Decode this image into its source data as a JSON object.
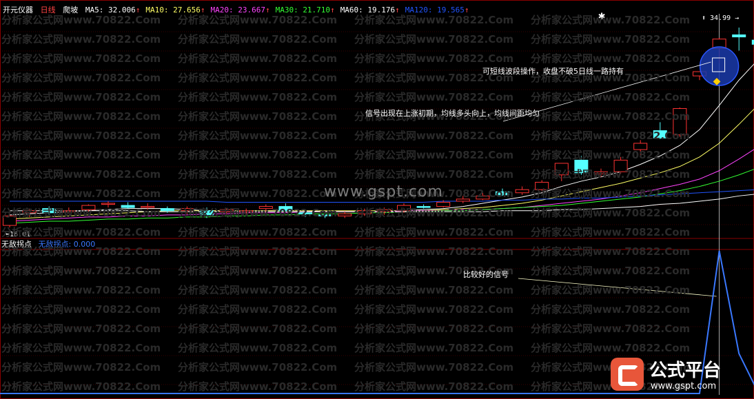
{
  "header": {
    "app_name": "开元仪器",
    "period": "日线",
    "indicator": "爬坡",
    "ma": [
      {
        "label": "MA5: 32.006",
        "arrow": "↑",
        "color": "#ffffff"
      },
      {
        "label": "MA10: 27.656",
        "arrow": "↑",
        "color": "#ffff66"
      },
      {
        "label": "MA20: 23.667",
        "arrow": "↑",
        "color": "#ff44ff"
      },
      {
        "label": "MA30: 21.710",
        "arrow": "↑",
        "color": "#33ff33"
      },
      {
        "label": "MA60: 19.176",
        "arrow": "↑",
        "color": "#ffffff"
      },
      {
        "label": "MA120: 19.565",
        "arrow": "↑",
        "color": "#2255ff"
      }
    ]
  },
  "sub_header": {
    "name": "无敌拐点",
    "value_label": "无敌拐点: 0.000"
  },
  "annotations": {
    "top": "可短线波段操作，收盘不破5日线一路持有",
    "middle": "信号出现在上涨初期，均线多头向上，均线间距均匀",
    "bottom": "比较好的信号"
  },
  "price_labels": {
    "high": "34.99",
    "low": "16.01"
  },
  "watermark": {
    "text": "分析家公式网www.70822.Com",
    "center": "www.gspt.com"
  },
  "logo": {
    "name": "公式平台",
    "site": "www.gspt.com"
  },
  "colors": {
    "up": "#ff3333",
    "down": "#55ffff",
    "signal": "#3a78ff",
    "grid": "#7a0000",
    "separator": "#8a0000",
    "circle": "#1a3aaa"
  },
  "chart_data": {
    "type": "candlestick",
    "price_range": [
      16.01,
      34.99
    ],
    "candles": [
      {
        "o": 16.2,
        "h": 17.3,
        "l": 16.0,
        "c": 17.1
      },
      {
        "o": 17.4,
        "h": 17.8,
        "l": 17.0,
        "c": 17.6
      },
      {
        "o": 17.8,
        "h": 18.0,
        "l": 17.2,
        "c": 17.4
      },
      {
        "o": 17.5,
        "h": 17.9,
        "l": 17.3,
        "c": 17.6
      },
      {
        "o": 17.7,
        "h": 18.2,
        "l": 17.5,
        "c": 18.1
      },
      {
        "o": 18.2,
        "h": 18.5,
        "l": 17.9,
        "c": 18.3
      },
      {
        "o": 18.1,
        "h": 18.4,
        "l": 17.8,
        "c": 17.9
      },
      {
        "o": 17.9,
        "h": 18.3,
        "l": 17.7,
        "c": 18.0
      },
      {
        "o": 17.8,
        "h": 18.0,
        "l": 17.4,
        "c": 17.6
      },
      {
        "o": 17.6,
        "h": 18.0,
        "l": 17.3,
        "c": 17.8
      },
      {
        "o": 17.6,
        "h": 17.9,
        "l": 16.9,
        "c": 17.2
      },
      {
        "o": 17.5,
        "h": 17.8,
        "l": 17.2,
        "c": 17.7
      },
      {
        "o": 17.6,
        "h": 17.8,
        "l": 17.2,
        "c": 17.6
      },
      {
        "o": 17.8,
        "h": 18.2,
        "l": 17.5,
        "c": 18.0
      },
      {
        "o": 18.0,
        "h": 18.3,
        "l": 17.5,
        "c": 17.6
      },
      {
        "o": 17.4,
        "h": 17.6,
        "l": 17.0,
        "c": 17.3
      },
      {
        "o": 17.2,
        "h": 17.4,
        "l": 16.9,
        "c": 17.1
      },
      {
        "o": 17.1,
        "h": 17.5,
        "l": 16.9,
        "c": 17.3
      },
      {
        "o": 17.3,
        "h": 17.8,
        "l": 17.1,
        "c": 17.6
      },
      {
        "o": 17.5,
        "h": 17.9,
        "l": 17.2,
        "c": 17.7
      },
      {
        "o": 17.6,
        "h": 18.3,
        "l": 17.4,
        "c": 18.1
      },
      {
        "o": 18.0,
        "h": 18.2,
        "l": 17.8,
        "c": 17.9
      },
      {
        "o": 18.0,
        "h": 18.6,
        "l": 17.9,
        "c": 18.4
      },
      {
        "o": 18.5,
        "h": 19.0,
        "l": 18.3,
        "c": 18.7
      },
      {
        "o": 18.7,
        "h": 19.3,
        "l": 18.6,
        "c": 19.0
      },
      {
        "o": 19.4,
        "h": 19.7,
        "l": 19.0,
        "c": 19.1
      },
      {
        "o": 19.3,
        "h": 19.9,
        "l": 19.1,
        "c": 19.6
      },
      {
        "o": 19.6,
        "h": 20.5,
        "l": 19.4,
        "c": 20.3
      },
      {
        "o": 21.0,
        "h": 21.4,
        "l": 20.4,
        "c": 22.1
      },
      {
        "o": 22.4,
        "h": 22.8,
        "l": 21.0,
        "c": 21.2
      },
      {
        "o": 21.1,
        "h": 21.6,
        "l": 20.8,
        "c": 21.3
      },
      {
        "o": 21.3,
        "h": 22.7,
        "l": 21.1,
        "c": 22.4
      },
      {
        "o": 23.4,
        "h": 24.3,
        "l": 22.9,
        "c": 24.0
      },
      {
        "o": 25.2,
        "h": 26.0,
        "l": 24.4,
        "c": 24.5
      },
      {
        "o": 24.8,
        "h": 27.4,
        "l": 24.6,
        "c": 27.3
      },
      {
        "o": 30.4,
        "h": 30.8,
        "l": 30.0,
        "c": 30.8
      },
      {
        "o": 33.0,
        "h": 34.0,
        "l": 31.6,
        "c": 33.9
      },
      {
        "o": 34.3,
        "h": 34.99,
        "l": 32.8,
        "c": 34.1
      },
      {
        "o": 33.8,
        "h": 34.7,
        "l": 32.6,
        "c": 33.4
      }
    ],
    "ma_series": [
      {
        "name": "MA5",
        "color": "#ffffff",
        "values": [
          17.2,
          17.3,
          17.4,
          17.5,
          17.6,
          17.7,
          17.8,
          17.8,
          17.8,
          17.7,
          17.6,
          17.6,
          17.6,
          17.6,
          17.6,
          17.6,
          17.5,
          17.5,
          17.5,
          17.5,
          17.6,
          17.7,
          17.8,
          18.0,
          18.3,
          18.6,
          18.9,
          19.3,
          19.9,
          20.4,
          20.8,
          21.3,
          22.0,
          22.8,
          23.8,
          25.3,
          27.6,
          30.0,
          32.0
        ]
      },
      {
        "name": "MA10",
        "color": "#ffff66",
        "values": [
          16.8,
          16.9,
          17.0,
          17.1,
          17.2,
          17.3,
          17.4,
          17.5,
          17.6,
          17.6,
          17.6,
          17.6,
          17.6,
          17.6,
          17.6,
          17.6,
          17.6,
          17.6,
          17.6,
          17.6,
          17.6,
          17.6,
          17.7,
          17.8,
          17.9,
          18.1,
          18.3,
          18.6,
          19.0,
          19.4,
          19.8,
          20.2,
          20.7,
          21.2,
          21.8,
          22.7,
          24.0,
          25.8,
          27.7
        ]
      },
      {
        "name": "MA20",
        "color": "#ff44ff",
        "values": [
          16.6,
          16.7,
          16.8,
          16.9,
          17.0,
          17.0,
          17.1,
          17.1,
          17.2,
          17.2,
          17.3,
          17.3,
          17.4,
          17.4,
          17.4,
          17.5,
          17.5,
          17.5,
          17.5,
          17.5,
          17.6,
          17.6,
          17.6,
          17.7,
          17.7,
          17.8,
          17.9,
          18.1,
          18.3,
          18.5,
          18.7,
          19.0,
          19.3,
          19.7,
          20.1,
          20.6,
          21.4,
          22.5,
          23.7
        ]
      },
      {
        "name": "MA30",
        "color": "#33ff33",
        "values": [
          16.4,
          16.5,
          16.6,
          16.6,
          16.7,
          16.8,
          16.8,
          16.9,
          16.9,
          17.0,
          17.0,
          17.1,
          17.1,
          17.2,
          17.2,
          17.3,
          17.3,
          17.3,
          17.4,
          17.4,
          17.5,
          17.5,
          17.6,
          17.6,
          17.7,
          17.8,
          17.9,
          18.0,
          18.1,
          18.3,
          18.5,
          18.7,
          18.9,
          19.2,
          19.5,
          19.9,
          20.4,
          21.0,
          21.7
        ]
      },
      {
        "name": "MA60",
        "color": "#ffffff",
        "values": [
          17.6,
          17.6,
          17.6,
          17.6,
          17.6,
          17.6,
          17.6,
          17.5,
          17.5,
          17.5,
          17.5,
          17.5,
          17.5,
          17.5,
          17.5,
          17.5,
          17.5,
          17.5,
          17.5,
          17.5,
          17.5,
          17.5,
          17.5,
          17.5,
          17.5,
          17.6,
          17.6,
          17.6,
          17.7,
          17.7,
          17.8,
          17.9,
          18.0,
          18.2,
          18.3,
          18.5,
          18.7,
          19.0,
          19.2
        ]
      },
      {
        "name": "MA120",
        "color": "#2255ff",
        "values": [
          18.5,
          18.5,
          18.5,
          18.5,
          18.5,
          18.5,
          18.5,
          18.5,
          18.5,
          18.5,
          18.5,
          18.4,
          18.4,
          18.4,
          18.4,
          18.4,
          18.4,
          18.4,
          18.4,
          18.4,
          18.4,
          18.4,
          18.5,
          18.5,
          18.5,
          18.6,
          18.6,
          18.7,
          18.7,
          18.8,
          18.8,
          18.9,
          19.0,
          19.1,
          19.2,
          19.3,
          19.4,
          19.5,
          19.6
        ]
      }
    ],
    "signal": {
      "name": "无敌拐点",
      "values": [
        0,
        0,
        0,
        0,
        0,
        0,
        0,
        0,
        0,
        0,
        0,
        0,
        0,
        0,
        0,
        0,
        0,
        0,
        0,
        0,
        0,
        0,
        0,
        0,
        0,
        0,
        0,
        0,
        0,
        0,
        0,
        0,
        0,
        0,
        0,
        0,
        1,
        0.28,
        0
      ]
    }
  }
}
